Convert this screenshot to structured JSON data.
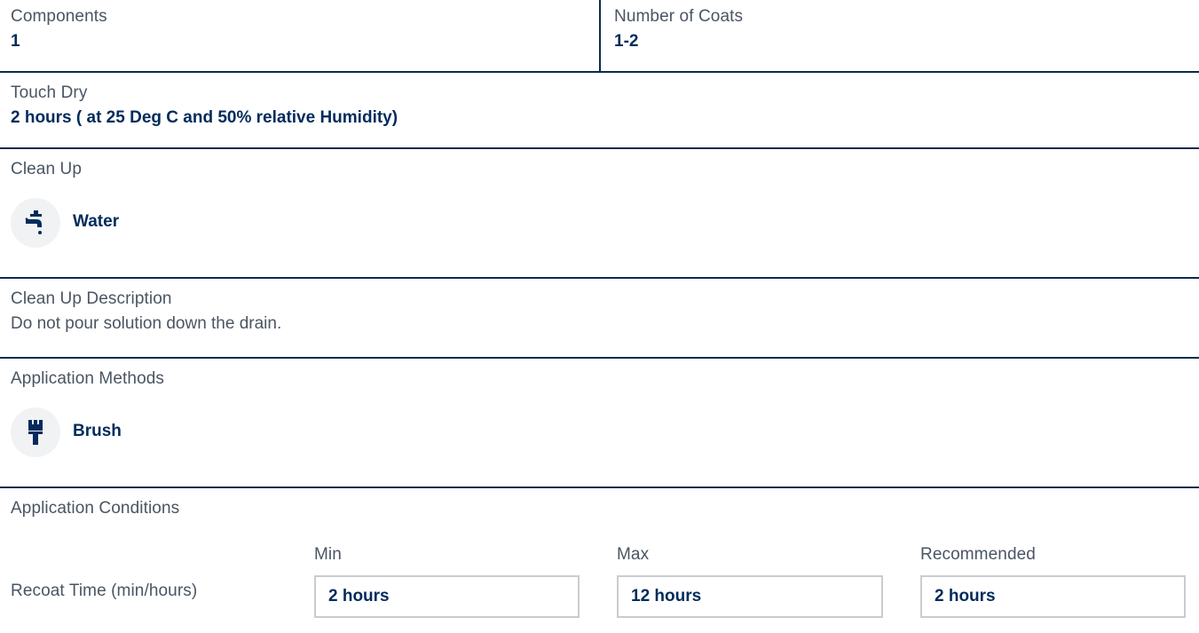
{
  "components": {
    "label": "Components",
    "value": "1"
  },
  "coats": {
    "label": "Number of Coats",
    "value": "1-2"
  },
  "touch_dry": {
    "label": "Touch Dry",
    "value": "2 hours ( at 25 Deg C and 50% relative Humidity)"
  },
  "clean_up": {
    "label": "Clean Up",
    "icon": "faucet-icon",
    "item": "Water"
  },
  "clean_up_description": {
    "label": "Clean Up Description",
    "value": "Do not pour solution down the drain."
  },
  "application_methods": {
    "label": "Application Methods",
    "icon": "paint-brush-icon",
    "item": "Brush"
  },
  "application_conditions": {
    "label": "Application Conditions",
    "row_label": "Recoat Time (min/hours)",
    "columns": [
      {
        "header": "Min",
        "value": "2 hours"
      },
      {
        "header": "Max",
        "value": "12 hours"
      },
      {
        "header": "Recommended",
        "value": "2 hours"
      }
    ]
  },
  "colors": {
    "primary": "#002b5c",
    "label": "#4a5563",
    "divider": "#0b2a4f",
    "icon_bg": "#f1f2f3",
    "field_border": "#c9ccd1"
  }
}
